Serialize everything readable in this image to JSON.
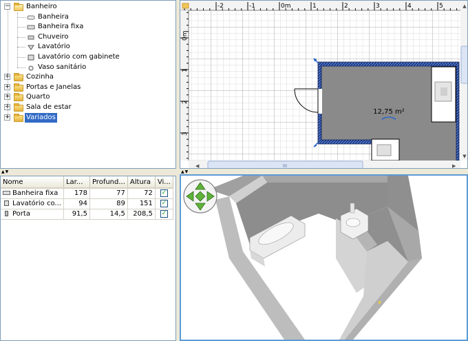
{
  "tree": {
    "items": [
      {
        "label": "Banheiro",
        "level": 0,
        "type": "folder",
        "expanded": true
      },
      {
        "label": "Banheira",
        "level": 1,
        "type": "item",
        "icon": "bathtub-icon"
      },
      {
        "label": "Banheira fixa",
        "level": 1,
        "type": "item",
        "icon": "fixed-bathtub-icon"
      },
      {
        "label": "Chuveiro",
        "level": 1,
        "type": "item",
        "icon": "shower-icon"
      },
      {
        "label": "Lavatório",
        "level": 1,
        "type": "item",
        "icon": "washbasin-icon"
      },
      {
        "label": "Lavatório com gabinete",
        "level": 1,
        "type": "item",
        "icon": "washbasin-cabinet-icon"
      },
      {
        "label": "Vaso sanitário",
        "level": 1,
        "type": "item",
        "icon": "toilet-icon"
      },
      {
        "label": "Cozinha",
        "level": 0,
        "type": "folder",
        "expanded": false
      },
      {
        "label": "Portas e Janelas",
        "level": 0,
        "type": "folder",
        "expanded": false
      },
      {
        "label": "Quarto",
        "level": 0,
        "type": "folder",
        "expanded": false
      },
      {
        "label": "Sala de estar",
        "level": 0,
        "type": "folder",
        "expanded": false
      },
      {
        "label": "Variados",
        "level": 0,
        "type": "folder",
        "expanded": false,
        "selected": true
      }
    ]
  },
  "furniture_table": {
    "columns": [
      "Nome",
      "Lar...",
      "Profund...",
      "Altura",
      "Vi..."
    ],
    "rows": [
      {
        "name": "Banheira fixa",
        "width": "178",
        "depth": "77",
        "height": "72",
        "visible": true,
        "icon": "fixed-bathtub-icon"
      },
      {
        "name": "Lavatório co...",
        "width": "94",
        "depth": "89",
        "height": "151",
        "visible": true,
        "icon": "washbasin-cabinet-icon"
      },
      {
        "name": "Porta",
        "width": "91,5",
        "depth": "14,5",
        "height": "208,5",
        "visible": true,
        "icon": "door-icon"
      }
    ]
  },
  "plan": {
    "ruler_x": [
      "-2",
      "-1",
      "0m",
      "1",
      "2",
      "3",
      "4",
      "5"
    ],
    "ruler_y": [
      "0m",
      "1",
      "2",
      "3"
    ],
    "room_area": "12,75 m²",
    "scrollbar_thumb": "III",
    "room_fill": "#8a8a8a",
    "wall_color": "#1a3a8a"
  },
  "view3d": {
    "nav_arrows": "navigation-arrows-icon"
  },
  "colors": {
    "selection": "#316ac5",
    "accent_border": "#5c9ad6"
  }
}
